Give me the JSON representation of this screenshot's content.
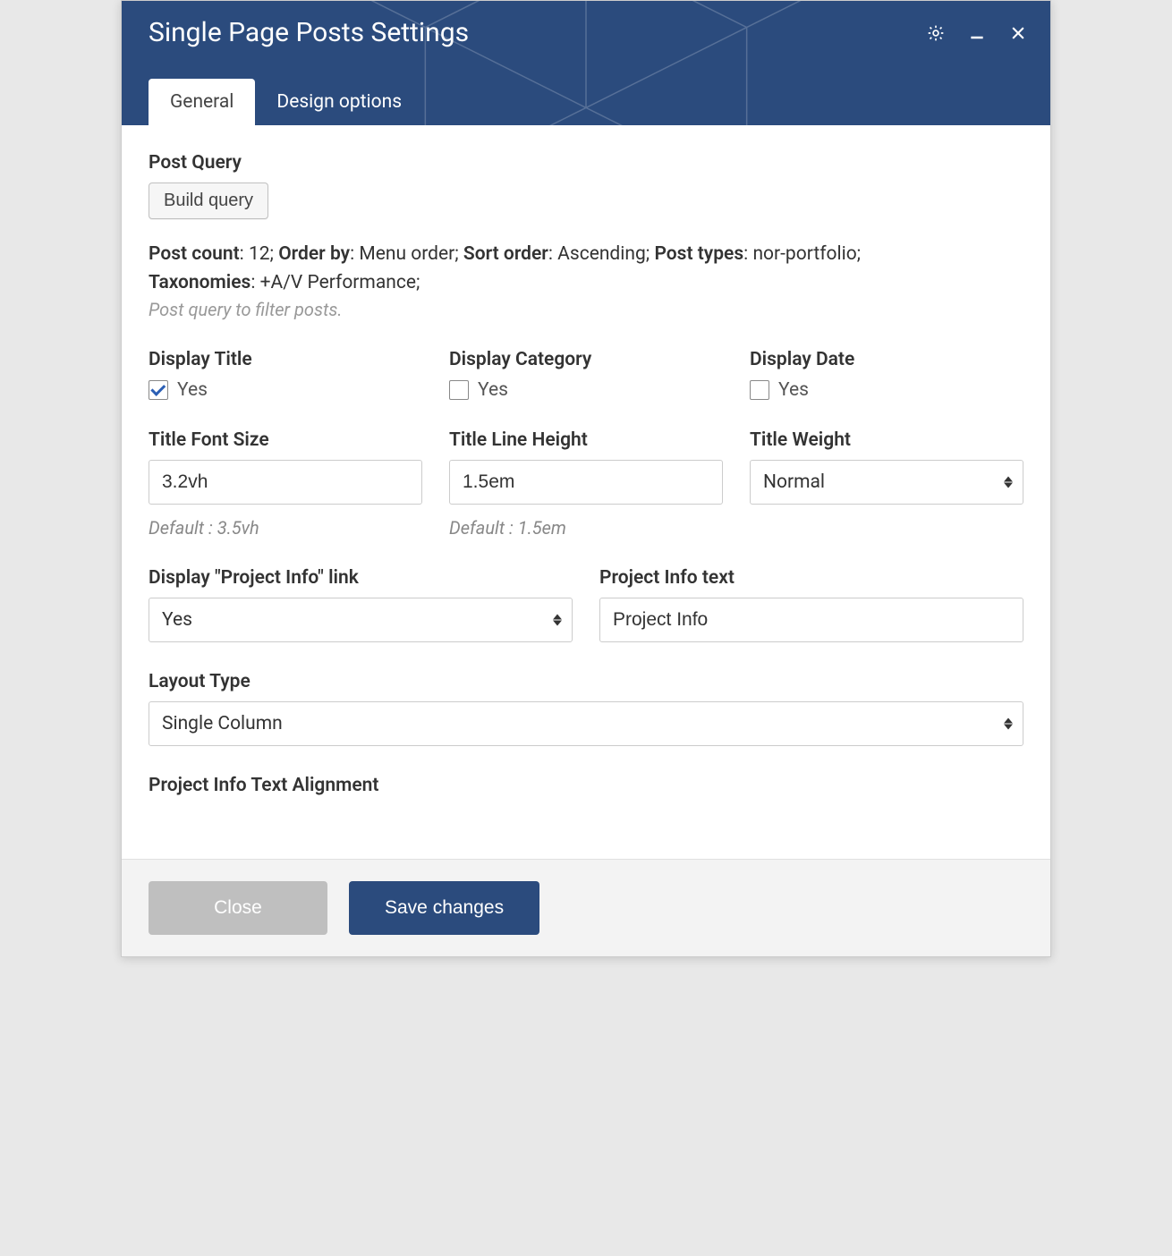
{
  "header": {
    "title": "Single Page Posts Settings"
  },
  "tabs": {
    "general": "General",
    "design": "Design options"
  },
  "postQuery": {
    "label": "Post Query",
    "buildButton": "Build query",
    "summary": {
      "postCountLabel": "Post count",
      "postCountValue": "12",
      "orderByLabel": "Order by",
      "orderByValue": "Menu order",
      "sortOrderLabel": "Sort order",
      "sortOrderValue": "Ascending",
      "postTypesLabel": "Post types",
      "postTypesValue": "nor-portfolio",
      "taxonomiesLabel": "Taxonomies",
      "taxonomiesValue": "+A/V Performance"
    },
    "help": "Post query to filter posts."
  },
  "display": {
    "titleLabel": "Display Title",
    "titleChecked": true,
    "categoryLabel": "Display Category",
    "categoryChecked": false,
    "dateLabel": "Display Date",
    "dateChecked": false,
    "yes": "Yes"
  },
  "titleFont": {
    "sizeLabel": "Title Font Size",
    "sizeValue": "3.2vh",
    "sizeHint": "Default : 3.5vh",
    "lineHeightLabel": "Title Line Height",
    "lineHeightValue": "1.5em",
    "lineHeightHint": "Default : 1.5em",
    "weightLabel": "Title Weight",
    "weightValue": "Normal"
  },
  "projectInfo": {
    "linkLabel": "Display \"Project Info\" link",
    "linkValue": "Yes",
    "textLabel": "Project Info text",
    "textValue": "Project Info"
  },
  "layout": {
    "typeLabel": "Layout Type",
    "typeValue": "Single Column",
    "alignLabel": "Project Info Text Alignment"
  },
  "footer": {
    "close": "Close",
    "save": "Save changes"
  }
}
